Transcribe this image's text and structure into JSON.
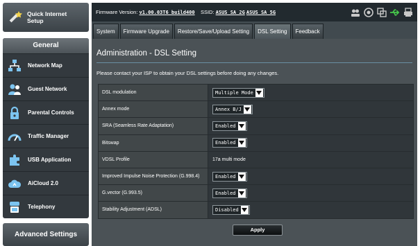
{
  "sidebar": {
    "quick_setup_label": "Quick Internet Setup",
    "general_title": "General",
    "items": [
      {
        "label": "Network Map"
      },
      {
        "label": "Guest Network"
      },
      {
        "label": "Parental Controls"
      },
      {
        "label": "Traffic Manager"
      },
      {
        "label": "USB Application"
      },
      {
        "label": "AiCloud 2.0"
      },
      {
        "label": "Telephony"
      }
    ],
    "advanced_label": "Advanced Settings"
  },
  "topbar": {
    "firmware_label": "Firmware Version:",
    "firmware_value": "v1.00.03T6_build400",
    "ssid_label": "SSID:",
    "ssid_1": "ASUS_SA_2G",
    "ssid_2": "ASUS_SA_5G"
  },
  "tabs": [
    {
      "label": "System"
    },
    {
      "label": "Firmware Upgrade"
    },
    {
      "label": "Restore/Save/Upload Setting"
    },
    {
      "label": "DSL Setting",
      "active": true
    },
    {
      "label": "Feedback"
    }
  ],
  "page": {
    "title": "Administration - DSL Setting",
    "description": "Please contact your ISP to obtain your DSL settings before doing any changes."
  },
  "settings": [
    {
      "label": "DSL modulation",
      "value": "Multiple Mode",
      "type": "select"
    },
    {
      "label": "Annex mode",
      "value": "Annex B/J",
      "type": "select"
    },
    {
      "label": "SRA (Seamless Rate Adaptation)",
      "value": "Enabled",
      "type": "select"
    },
    {
      "label": "Bitswap",
      "value": "Enabled",
      "type": "select"
    },
    {
      "label": "VDSL Profile",
      "value": "17a multi mode",
      "type": "text"
    },
    {
      "label": "Improved Impulse Noise Protection (G.998.4)",
      "value": "Enabled",
      "type": "select"
    },
    {
      "label": "G.vector (G.993.5)",
      "value": "Enabled",
      "type": "select"
    },
    {
      "label": "Stability Adjustment (ADSL)",
      "value": "Disabled",
      "type": "select"
    }
  ],
  "apply_label": "Apply"
}
